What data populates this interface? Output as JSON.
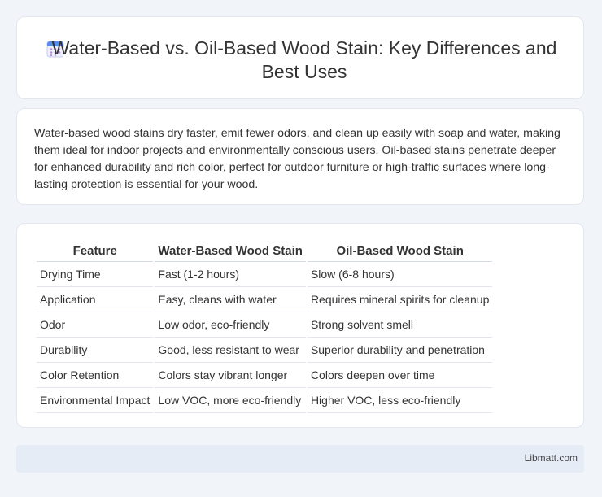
{
  "header": {
    "icon": "calendar-icon",
    "title": "Water-Based vs. Oil-Based Wood Stain: Key Differences and Best Uses"
  },
  "summary": "Water-based wood stains dry faster, emit fewer odors, and clean up easily with soap and water, making them ideal for indoor projects and environmentally conscious users. Oil-based stains penetrate deeper for enhanced durability and rich color, perfect for outdoor furniture or high-traffic surfaces where long-lasting protection is essential for your wood.",
  "table": {
    "headers": [
      "Feature",
      "Water-Based Wood Stain",
      "Oil-Based Wood Stain"
    ],
    "rows": [
      [
        "Drying Time",
        "Fast (1-2 hours)",
        "Slow (6-8 hours)"
      ],
      [
        "Application",
        "Easy, cleans with water",
        "Requires mineral spirits for cleanup"
      ],
      [
        "Odor",
        "Low odor, eco-friendly",
        "Strong solvent smell"
      ],
      [
        "Durability",
        "Good, less resistant to wear",
        "Superior durability and penetration"
      ],
      [
        "Color Retention",
        "Colors stay vibrant longer",
        "Colors deepen over time"
      ],
      [
        "Environmental Impact",
        "Low VOC, more eco-friendly",
        "Higher VOC, less eco-friendly"
      ]
    ]
  },
  "footer": {
    "site": "Libmatt.com"
  }
}
